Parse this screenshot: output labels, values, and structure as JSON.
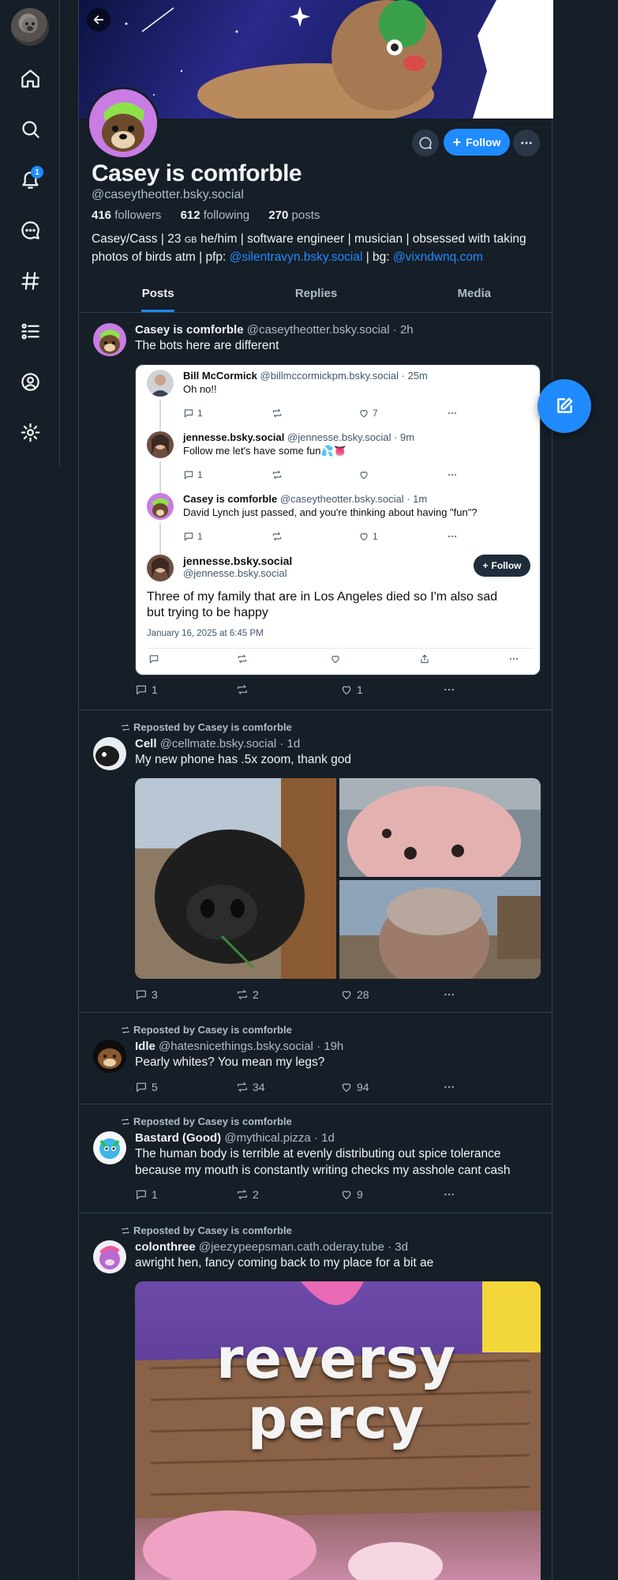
{
  "nav": {
    "items": [
      {
        "name": "home",
        "icon": "home-icon"
      },
      {
        "name": "search",
        "icon": "search-icon"
      },
      {
        "name": "notifications",
        "icon": "bell-icon",
        "badge": "1"
      },
      {
        "name": "chat",
        "icon": "chat-icon"
      },
      {
        "name": "feeds",
        "icon": "hashtag-icon"
      },
      {
        "name": "lists",
        "icon": "list-icon"
      },
      {
        "name": "profile",
        "icon": "user-circle-icon"
      },
      {
        "name": "settings",
        "icon": "gear-icon"
      }
    ]
  },
  "profile": {
    "display_name": "Casey is comforble",
    "handle": "@caseytheotter.bsky.social",
    "followers_count": "416",
    "followers_label": "followers",
    "following_count": "612",
    "following_label": "following",
    "posts_count": "270",
    "posts_label": "posts",
    "bio_line1": "Casey/Cass | 23 ",
    "bio_gb": "GB",
    "bio_line1b": " he/him | software engineer | musician | obsessed with taking",
    "bio_line2a": "photos of birds atm | pfp: ",
    "bio_link1": "@silentravyn.bsky.social",
    "bio_line2b": " | bg: ",
    "bio_link2": "@vixndwnq.com",
    "follow_label": "Follow"
  },
  "tabs": [
    {
      "label": "Posts",
      "active": true
    },
    {
      "label": "Replies",
      "active": false
    },
    {
      "label": "Media",
      "active": false
    }
  ],
  "posts": [
    {
      "author": "Casey is comforble",
      "handle": "@caseytheotter.bsky.social",
      "time": "· 2h",
      "text": "The bots here are different",
      "replies": "1",
      "reposts": "",
      "likes": "1",
      "embed": {
        "items": [
          {
            "author": "Bill McCormick",
            "handle": "@billmccormickpm.bsky.social",
            "time": "· 25m",
            "text": "Oh no!!",
            "replies": "1",
            "reposts": "",
            "likes": "7"
          },
          {
            "author": "jennesse.bsky.social",
            "handle": "@jennesse.bsky.social",
            "time": "· 9m",
            "text": "Follow me let's have some fun💦👅",
            "replies": "1",
            "reposts": "",
            "likes": ""
          },
          {
            "author": "Casey is comforble",
            "handle": "@caseytheotter.bsky.social",
            "time": "· 1m",
            "text": "David Lynch just passed, and you're thinking about having \"fun\"?",
            "replies": "1",
            "reposts": "",
            "likes": "1"
          }
        ],
        "main": {
          "author": "jennesse.bsky.social",
          "handle": "@jennesse.bsky.social",
          "follow_label": "Follow",
          "text": "Three of my family that are in Los Angeles died so I'm also sad but trying to be happy",
          "date": "January 16, 2025 at 6:45 PM"
        }
      }
    },
    {
      "reposted_by": "Reposted by Casey is comforble",
      "author": "Cell",
      "handle": "@cellmate.bsky.social",
      "time": "· 1d",
      "text": "My new phone has .5x zoom, thank god",
      "replies": "3",
      "reposts": "2",
      "likes": "28"
    },
    {
      "reposted_by": "Reposted by Casey is comforble",
      "author": "Idle",
      "handle": "@hatesnicethings.bsky.social",
      "time": "· 19h",
      "text": "Pearly whites? You mean my legs?",
      "replies": "5",
      "reposts": "34",
      "likes": "94"
    },
    {
      "reposted_by": "Reposted by Casey is comforble",
      "author": "Bastard (Good)",
      "handle": "@mythical.pizza",
      "time": "· 1d",
      "text": "The human body is terrible at evenly distributing out spice tolerance because my mouth is constantly writing checks my asshole cant cash",
      "replies": "1",
      "reposts": "2",
      "likes": "9"
    },
    {
      "reposted_by": "Reposted by Casey is comforble",
      "author": "colonthree",
      "handle": "@jeezypeepsman.cath.oderay.tube",
      "time": "· 3d",
      "text": "awright hen, fancy coming back to my place for a bit ae",
      "image_text": "reversy percy"
    }
  ],
  "colors": {
    "background": "#161e27",
    "accent": "#208bfe",
    "border": "#2e4052",
    "muted_text": "#aebbc9"
  }
}
